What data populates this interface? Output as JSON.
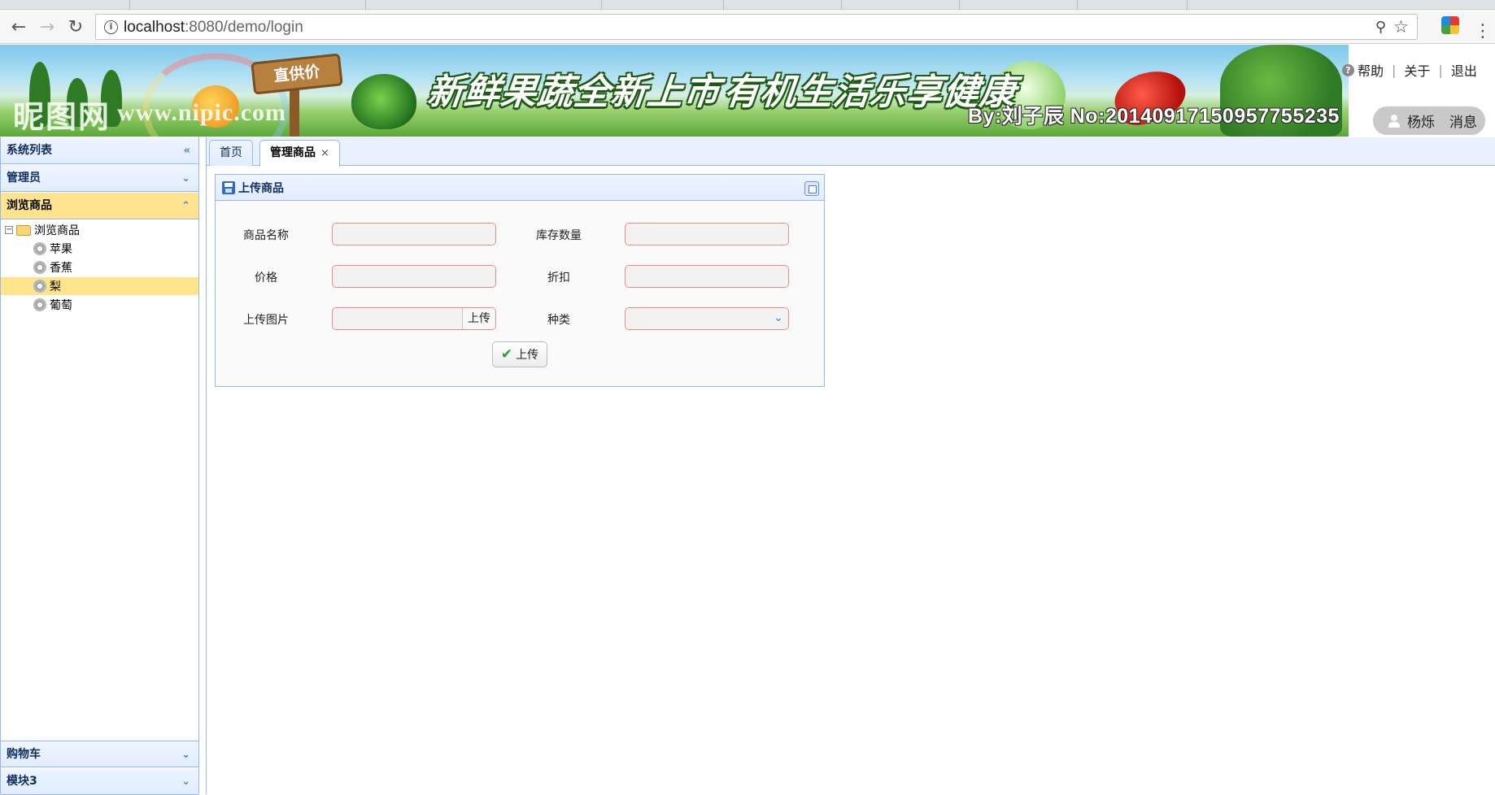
{
  "browser": {
    "url_host": "localhost",
    "url_path": ":8080/demo/login"
  },
  "banner": {
    "logo": "昵图网",
    "logo_url": "www.nipic.com",
    "sign": "直供价",
    "slogan1": "新鲜果蔬全新上市",
    "slogan2": "有机生活乐享健康",
    "credit": "By:刘子辰 No:20140917150957755235"
  },
  "top_links": {
    "help": "帮助",
    "about": "关于",
    "logout": "退出"
  },
  "user": {
    "name": "杨烁",
    "messages": "消息"
  },
  "sidebar": {
    "title": "系统列表",
    "sections": [
      {
        "label": "管理员"
      },
      {
        "label": "浏览商品"
      },
      {
        "label": "购物车"
      },
      {
        "label": "模块3"
      }
    ],
    "tree": {
      "root": "浏览商品",
      "children": [
        "苹果",
        "香蕉",
        "梨",
        "葡萄"
      ],
      "selected_index": 2
    }
  },
  "tabs": [
    {
      "label": "首页"
    },
    {
      "label": "管理商品"
    }
  ],
  "panel": {
    "title": "上传商品",
    "fields": {
      "name_label": "商品名称",
      "stock_label": "库存数量",
      "price_label": "价格",
      "discount_label": "折扣",
      "image_label": "上传图片",
      "image_button": "上传",
      "category_label": "种类"
    },
    "submit_label": "上传"
  }
}
